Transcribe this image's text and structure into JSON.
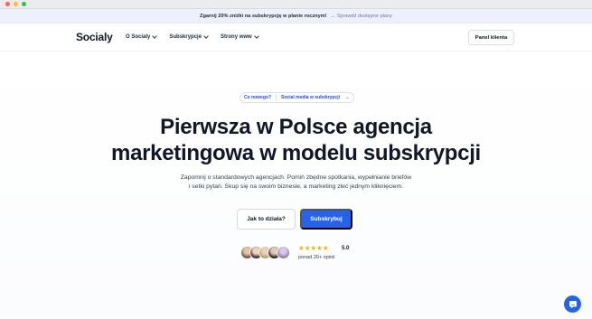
{
  "promo": {
    "text": "Zgarnij 20% zniżki na subskrypcję w planie rocznym!",
    "link": "→ Sprawdź dostępne plany"
  },
  "nav": {
    "logo": "Socialy",
    "menu": [
      "O Socialy",
      "Subskrypcje",
      "Strony www"
    ],
    "panel_button": "Panel klienta"
  },
  "hero": {
    "pill_tag": "Co nowego?",
    "pill_link": "Social media w subskrypcji",
    "pill_arrow": "→",
    "headline_line1": "Pierwsza w Polsce agencja",
    "headline_line2": "marketingowa w modelu subskrypcji",
    "sub_line1": "Zapomnij o standardowych agencjach. Pomiń zbędne spotkania, wypełnianie briefów",
    "sub_line2": "i setki pytań. Skup się na swoim biznesie, a marketing zleć jednym kliknięciem.",
    "btn_how": "Jak to działa?",
    "btn_subscribe": "Subskrybuj"
  },
  "social_proof": {
    "stars": "★★★★★",
    "rating": "5.0",
    "reviews": "ponad 20+ opinii"
  },
  "colors": {
    "accent": "#2563eb",
    "star": "#f5b301",
    "promo_bg": "#eef1fb"
  },
  "icons": {
    "chat": "chat-bubble-icon",
    "chevron": "chevron-down-icon"
  }
}
